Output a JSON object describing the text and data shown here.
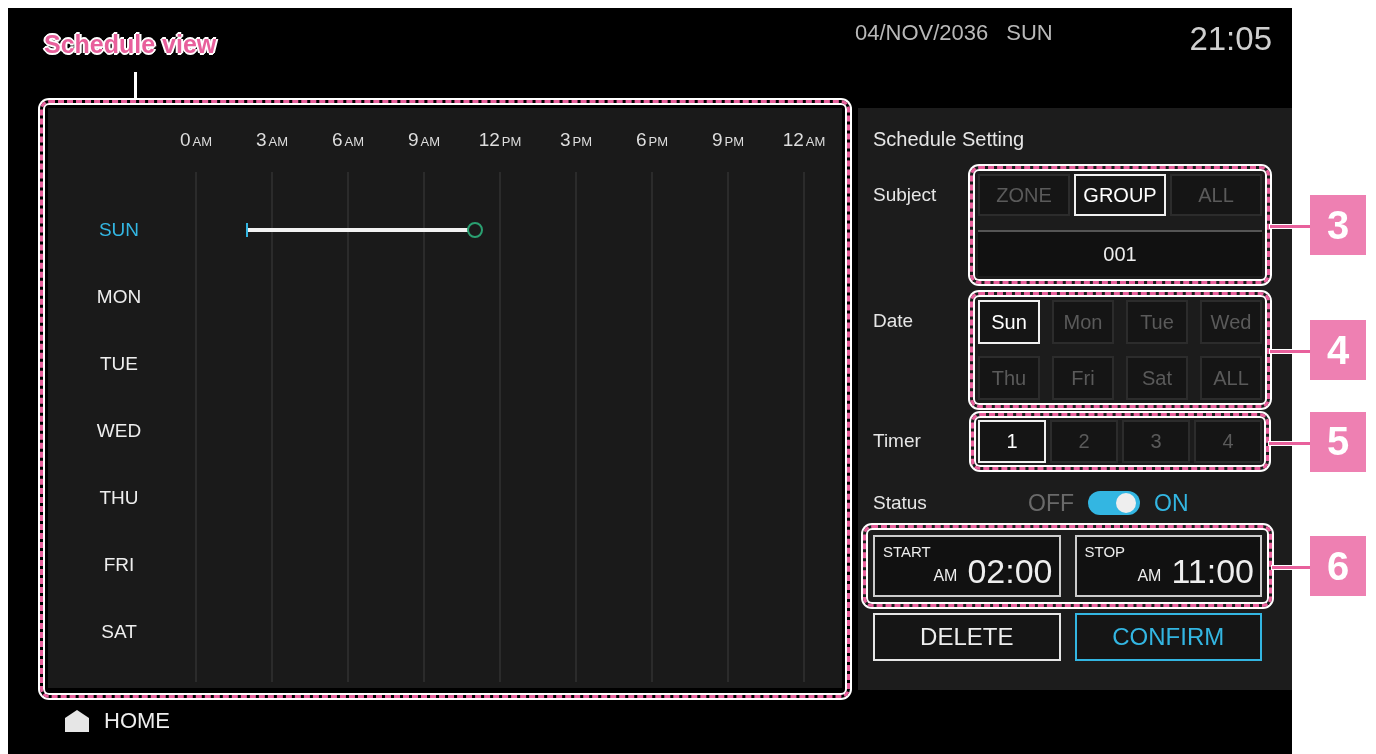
{
  "header": {
    "date": "04/NOV/2036",
    "weekday": "SUN",
    "time": "21:05"
  },
  "schedule_view": {
    "hours": [
      {
        "number": "0",
        "suffix": "AM"
      },
      {
        "number": "3",
        "suffix": "AM"
      },
      {
        "number": "6",
        "suffix": "AM"
      },
      {
        "number": "9",
        "suffix": "AM"
      },
      {
        "number": "12",
        "suffix": "PM"
      },
      {
        "number": "3",
        "suffix": "PM"
      },
      {
        "number": "6",
        "suffix": "PM"
      },
      {
        "number": "9",
        "suffix": "PM"
      },
      {
        "number": "12",
        "suffix": "AM"
      }
    ],
    "days": [
      {
        "label": "SUN",
        "selected": true,
        "scheduled": true
      },
      {
        "label": "MON",
        "selected": false,
        "scheduled": false
      },
      {
        "label": "TUE",
        "selected": false,
        "scheduled": false
      },
      {
        "label": "WED",
        "selected": false,
        "scheduled": false
      },
      {
        "label": "THU",
        "selected": false,
        "scheduled": false
      },
      {
        "label": "FRI",
        "selected": false,
        "scheduled": false
      },
      {
        "label": "SAT",
        "selected": false,
        "scheduled": false
      }
    ]
  },
  "settings": {
    "title": "Schedule Setting",
    "subject": {
      "label": "Subject",
      "options": [
        {
          "label": "ZONE",
          "selected": false
        },
        {
          "label": "GROUP",
          "selected": true
        },
        {
          "label": "ALL",
          "selected": false
        }
      ],
      "value": "001"
    },
    "date": {
      "label": "Date",
      "options": [
        {
          "label": "Sun",
          "selected": true
        },
        {
          "label": "Mon",
          "selected": false
        },
        {
          "label": "Tue",
          "selected": false
        },
        {
          "label": "Wed",
          "selected": false
        },
        {
          "label": "Thu",
          "selected": false
        },
        {
          "label": "Fri",
          "selected": false
        },
        {
          "label": "Sat",
          "selected": false
        },
        {
          "label": "ALL",
          "selected": false
        }
      ]
    },
    "timer": {
      "label": "Timer",
      "options": [
        {
          "label": "1",
          "selected": true
        },
        {
          "label": "2",
          "selected": false
        },
        {
          "label": "3",
          "selected": false
        },
        {
          "label": "4",
          "selected": false
        }
      ]
    },
    "status": {
      "label": "Status",
      "off_label": "OFF",
      "on_label": "ON",
      "on": true
    },
    "times": [
      {
        "label": "START",
        "period": "AM",
        "time": "02:00"
      },
      {
        "label": "STOP",
        "period": "AM",
        "time": "11:00"
      }
    ],
    "buttons": [
      {
        "label": "DELETE",
        "kind": "plain"
      },
      {
        "label": "CONFIRM",
        "kind": "primary"
      }
    ]
  },
  "home": {
    "label": "HOME"
  },
  "annotations": {
    "title": "Schedule view",
    "callouts": [
      "3",
      "4",
      "5",
      "6"
    ]
  }
}
